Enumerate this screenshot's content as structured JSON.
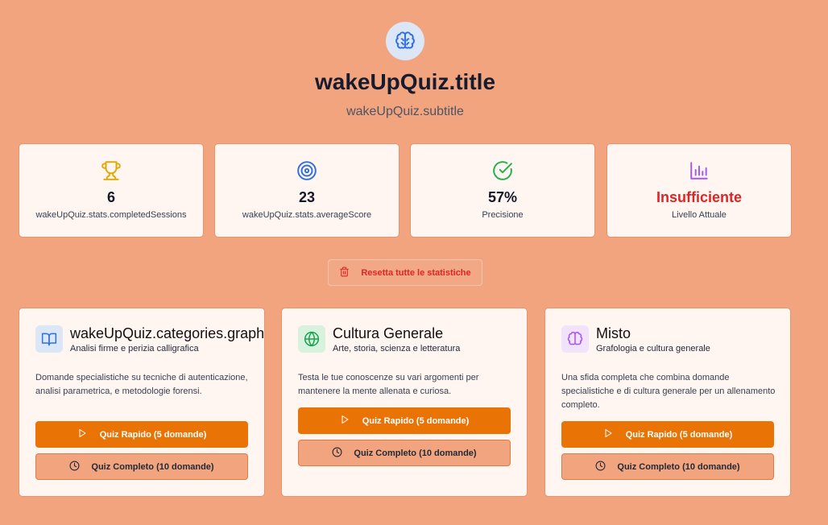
{
  "header": {
    "icon": "brain-icon",
    "title": "wakeUpQuiz.title",
    "subtitle": "wakeUpQuiz.subtitle"
  },
  "stats": [
    {
      "icon": "trophy-icon",
      "value": "6",
      "label": "wakeUpQuiz.stats.completedSessions",
      "color": "#e0a800"
    },
    {
      "icon": "target-icon",
      "value": "23",
      "label": "wakeUpQuiz.stats.averageScore",
      "color": "#2f6fe0"
    },
    {
      "icon": "check-circle-icon",
      "value": "57%",
      "label": "Precisione",
      "color": "#22b04b"
    },
    {
      "icon": "bar-chart-icon",
      "value": "Insufficiente",
      "label": "Livello Attuale",
      "color": "#a855f7",
      "value_color": "#dc2626"
    }
  ],
  "reset": {
    "label": "Resetta tutte le statistiche",
    "icon": "trash-icon"
  },
  "categories": [
    {
      "icon": "book-icon",
      "icon_bg": "#dbe6f7",
      "icon_color": "#2f6fe0",
      "name": "wakeUpQuiz.categories.graphology",
      "subtitle": "Analisi firme e perizia calligrafica",
      "description": "Domande specialistiche su tecniche di autenticazione, analisi parametrica, e metodologie forensi.",
      "quick_label": "Quiz Rapido (5 domande)",
      "full_label": "Quiz Completo (10 domande)"
    },
    {
      "icon": "globe-icon",
      "icon_bg": "#d9f2e0",
      "icon_color": "#16a34a",
      "name": "Cultura Generale",
      "subtitle": "Arte, storia, scienza e letteratura",
      "description": "Testa le tue conoscenze su vari argomenti per mantenere la mente allenata e curiosa.",
      "quick_label": "Quiz Rapido (5 domande)",
      "full_label": "Quiz Completo (10 domande)"
    },
    {
      "icon": "brain-icon",
      "icon_bg": "#f1e3fb",
      "icon_color": "#a855f7",
      "name": "Misto",
      "subtitle": "Grafologia e cultura generale",
      "description": "Una sfida completa che combina domande specialistiche e di cultura generale per un allenamento completo.",
      "quick_label": "Quiz Rapido (5 domande)",
      "full_label": "Quiz Completo (10 domande)"
    }
  ]
}
